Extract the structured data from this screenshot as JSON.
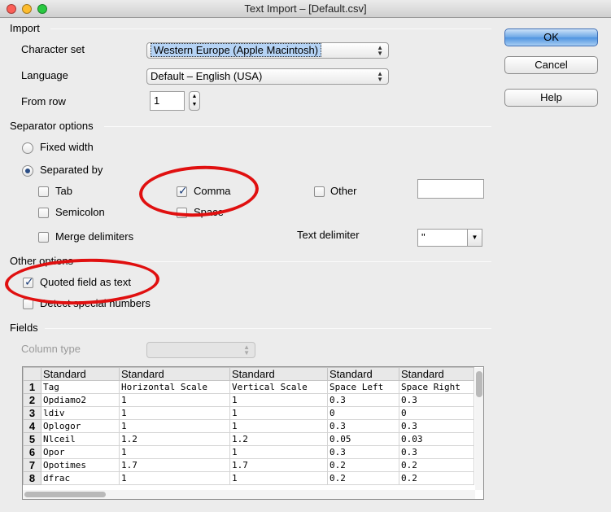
{
  "window": {
    "title": "Text Import – [Default.csv]"
  },
  "import_section": {
    "heading": "Import",
    "character_set_label": "Character set",
    "character_set_value": "Western Europe (Apple Macintosh)",
    "language_label": "Language",
    "language_value": "Default – English (USA)",
    "from_row_label": "From row",
    "from_row_value": "1"
  },
  "buttons": {
    "ok": "OK",
    "cancel": "Cancel",
    "help": "Help"
  },
  "separator_options": {
    "heading": "Separator options",
    "fixed_width": "Fixed width",
    "separated_by": "Separated by",
    "tab": "Tab",
    "comma": "Comma",
    "other": "Other",
    "semicolon": "Semicolon",
    "space": "Space",
    "merge_delimiters": "Merge delimiters",
    "text_delimiter_label": "Text delimiter",
    "text_delimiter_value": "\""
  },
  "other_options": {
    "heading": "Other options",
    "quoted_field": "Quoted field as text",
    "detect_special": "Detect special numbers"
  },
  "fields": {
    "heading": "Fields",
    "column_type_label": "Column type",
    "column_headers": [
      "Standard",
      "Standard",
      "Standard",
      "Standard",
      "Standard"
    ],
    "rows": [
      {
        "n": "1",
        "cells": [
          "Tag",
          "Horizontal Scale",
          "Vertical Scale",
          "Space Left",
          "Space Right"
        ]
      },
      {
        "n": "2",
        "cells": [
          "Opdiamo2",
          "1",
          "1",
          "0.3",
          "0.3"
        ]
      },
      {
        "n": "3",
        "cells": [
          "ldiv",
          "1",
          "1",
          "0",
          "0"
        ]
      },
      {
        "n": "4",
        "cells": [
          "Oplogor",
          "1",
          "1",
          "0.3",
          "0.3"
        ]
      },
      {
        "n": "5",
        "cells": [
          "Nlceil",
          "1.2",
          "1.2",
          "0.05",
          "0.03"
        ]
      },
      {
        "n": "6",
        "cells": [
          "Opor",
          "1",
          "1",
          "0.3",
          "0.3"
        ]
      },
      {
        "n": "7",
        "cells": [
          "Opotimes",
          "1.7",
          "1.7",
          "0.2",
          "0.2"
        ]
      },
      {
        "n": "8",
        "cells": [
          "dfrac",
          "1",
          "1",
          "0.2",
          "0.2"
        ]
      }
    ]
  },
  "colors": {
    "annotation_red": "#e01010",
    "ok_blue": "#4f93e0"
  }
}
